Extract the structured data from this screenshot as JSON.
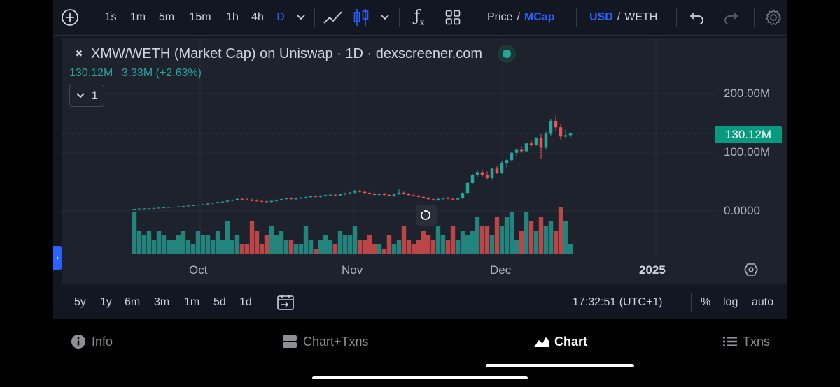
{
  "toolbar": {
    "intervals": [
      "1s",
      "1m",
      "5m",
      "15m",
      "1h",
      "4h",
      "D"
    ],
    "active_interval": "D",
    "price_label": "Price",
    "slash": "/",
    "mcap_label": "MCap",
    "currency_primary": "USD",
    "currency_secondary": "WETH"
  },
  "legend": {
    "title": "XMW/WETH (Market Cap) on Uniswap · 1D · dexscreener.com",
    "value": "130.12M",
    "change": "3.33M (+2.63%)",
    "collapse_count": "1"
  },
  "price_axis": {
    "labels": [
      "200.00M",
      "100.00M",
      "0.0000"
    ],
    "current_price": "130.12M"
  },
  "time_axis": {
    "labels": [
      "Oct",
      "Nov",
      "Dec",
      "2025"
    ]
  },
  "colors": {
    "up": "#26a69a",
    "down": "#ef5350",
    "accent": "#2962ff",
    "background": "#131722",
    "chart_bg": "#1e222d"
  },
  "chart_data": {
    "type": "candlestick",
    "price_axis_values": [
      0,
      100000000,
      200000000
    ],
    "last_price": 130120000,
    "ylim": [
      -20000000,
      240000000
    ],
    "candles": [
      {
        "o": 1.0,
        "h": 1.4,
        "l": 0.5,
        "c": 1.2
      },
      {
        "o": 1.2,
        "h": 1.7,
        "l": 0.9,
        "c": 1.6
      },
      {
        "o": 1.6,
        "h": 2.1,
        "l": 1.3,
        "c": 1.9
      },
      {
        "o": 1.9,
        "h": 2.3,
        "l": 1.5,
        "c": 2.1
      },
      {
        "o": 2.1,
        "h": 2.8,
        "l": 1.8,
        "c": 2.6
      },
      {
        "o": 2.6,
        "h": 3.3,
        "l": 2.3,
        "c": 3.1
      },
      {
        "o": 3.1,
        "h": 3.7,
        "l": 2.7,
        "c": 3.4
      },
      {
        "o": 3.4,
        "h": 4.4,
        "l": 3.0,
        "c": 4.2
      },
      {
        "o": 4.2,
        "h": 4.9,
        "l": 3.7,
        "c": 4.6
      },
      {
        "o": 4.6,
        "h": 5.6,
        "l": 4.1,
        "c": 5.3
      },
      {
        "o": 5.3,
        "h": 6.2,
        "l": 4.8,
        "c": 5.9
      },
      {
        "o": 5.9,
        "h": 7.0,
        "l": 5.3,
        "c": 6.7
      },
      {
        "o": 6.7,
        "h": 7.8,
        "l": 6.0,
        "c": 7.4
      },
      {
        "o": 7.4,
        "h": 8.6,
        "l": 6.6,
        "c": 8.2
      },
      {
        "o": 8.2,
        "h": 9.5,
        "l": 7.2,
        "c": 8.8
      },
      {
        "o": 8.8,
        "h": 10.8,
        "l": 7.9,
        "c": 10.2
      },
      {
        "o": 10.2,
        "h": 12.1,
        "l": 9.0,
        "c": 11.6
      },
      {
        "o": 11.6,
        "h": 13.4,
        "l": 10.5,
        "c": 12.8
      },
      {
        "o": 12.8,
        "h": 14.2,
        "l": 11.6,
        "c": 13.5
      },
      {
        "o": 13.5,
        "h": 15.7,
        "l": 12.2,
        "c": 15.1
      },
      {
        "o": 15.1,
        "h": 17.2,
        "l": 14.0,
        "c": 16.6
      },
      {
        "o": 16.6,
        "h": 19.0,
        "l": 15.4,
        "c": 18.2
      },
      {
        "o": 18.2,
        "h": 20.3,
        "l": 16.5,
        "c": 17.1
      },
      {
        "o": 17.1,
        "h": 19.8,
        "l": 15.3,
        "c": 16.0
      },
      {
        "o": 16.0,
        "h": 18.5,
        "l": 14.2,
        "c": 15.1
      },
      {
        "o": 15.1,
        "h": 17.3,
        "l": 13.6,
        "c": 14.4
      },
      {
        "o": 14.4,
        "h": 16.1,
        "l": 12.7,
        "c": 13.8
      },
      {
        "o": 13.8,
        "h": 15.9,
        "l": 11.9,
        "c": 13.1
      },
      {
        "o": 13.1,
        "h": 15.4,
        "l": 11.6,
        "c": 14.6
      },
      {
        "o": 14.6,
        "h": 17.1,
        "l": 13.1,
        "c": 16.4
      },
      {
        "o": 16.4,
        "h": 18.6,
        "l": 14.7,
        "c": 17.7
      },
      {
        "o": 17.7,
        "h": 19.4,
        "l": 16.0,
        "c": 18.9
      },
      {
        "o": 18.9,
        "h": 20.8,
        "l": 17.2,
        "c": 17.6
      },
      {
        "o": 17.6,
        "h": 20.1,
        "l": 16.3,
        "c": 19.3
      },
      {
        "o": 19.3,
        "h": 21.2,
        "l": 17.9,
        "c": 20.6
      },
      {
        "o": 20.6,
        "h": 22.3,
        "l": 18.6,
        "c": 21.1
      },
      {
        "o": 21.1,
        "h": 23.4,
        "l": 19.6,
        "c": 22.5
      },
      {
        "o": 22.5,
        "h": 24.1,
        "l": 20.8,
        "c": 21.7
      },
      {
        "o": 21.7,
        "h": 24.6,
        "l": 20.2,
        "c": 23.9
      },
      {
        "o": 23.9,
        "h": 25.8,
        "l": 22.1,
        "c": 24.7
      },
      {
        "o": 24.7,
        "h": 26.9,
        "l": 23.0,
        "c": 25.3
      },
      {
        "o": 25.3,
        "h": 27.4,
        "l": 23.4,
        "c": 24.2
      },
      {
        "o": 24.2,
        "h": 27.1,
        "l": 22.9,
        "c": 26.4
      },
      {
        "o": 26.4,
        "h": 28.8,
        "l": 24.5,
        "c": 27.7
      },
      {
        "o": 27.7,
        "h": 30.1,
        "l": 25.9,
        "c": 28.9
      },
      {
        "o": 28.9,
        "h": 33.5,
        "l": 27.2,
        "c": 31.8
      },
      {
        "o": 31.8,
        "h": 34.1,
        "l": 29.3,
        "c": 30.2
      },
      {
        "o": 30.2,
        "h": 31.9,
        "l": 27.6,
        "c": 28.4
      },
      {
        "o": 28.4,
        "h": 30.2,
        "l": 25.8,
        "c": 26.5
      },
      {
        "o": 26.5,
        "h": 28.7,
        "l": 24.3,
        "c": 25.1
      },
      {
        "o": 25.1,
        "h": 27.4,
        "l": 22.9,
        "c": 26.6
      },
      {
        "o": 26.6,
        "h": 28.8,
        "l": 24.0,
        "c": 25.0
      },
      {
        "o": 25.0,
        "h": 26.9,
        "l": 22.4,
        "c": 23.6
      },
      {
        "o": 23.6,
        "h": 27.3,
        "l": 21.9,
        "c": 26.4
      },
      {
        "o": 26.4,
        "h": 35.1,
        "l": 25.2,
        "c": 28.8
      },
      {
        "o": 28.8,
        "h": 30.7,
        "l": 25.6,
        "c": 26.8
      },
      {
        "o": 26.8,
        "h": 28.5,
        "l": 23.9,
        "c": 24.7
      },
      {
        "o": 24.7,
        "h": 26.2,
        "l": 22.1,
        "c": 23.2
      },
      {
        "o": 23.2,
        "h": 25.3,
        "l": 20.7,
        "c": 21.6
      },
      {
        "o": 21.6,
        "h": 23.4,
        "l": 19.1,
        "c": 19.9
      },
      {
        "o": 19.9,
        "h": 21.8,
        "l": 16.8,
        "c": 17.6
      },
      {
        "o": 17.6,
        "h": 19.6,
        "l": 14.9,
        "c": 16.1
      },
      {
        "o": 16.1,
        "h": 19.1,
        "l": 15.0,
        "c": 18.3
      },
      {
        "o": 18.3,
        "h": 20.6,
        "l": 16.9,
        "c": 19.6
      },
      {
        "o": 19.6,
        "h": 21.3,
        "l": 17.4,
        "c": 18.2
      },
      {
        "o": 18.2,
        "h": 20.2,
        "l": 15.9,
        "c": 17.1
      },
      {
        "o": 17.1,
        "h": 19.7,
        "l": 15.4,
        "c": 18.9
      },
      {
        "o": 18.9,
        "h": 29.3,
        "l": 18.2,
        "c": 28.4
      },
      {
        "o": 28.4,
        "h": 47.6,
        "l": 26.7,
        "c": 45.3
      },
      {
        "o": 45.3,
        "h": 61.1,
        "l": 43.5,
        "c": 58.5
      },
      {
        "o": 58.5,
        "h": 66.7,
        "l": 55.2,
        "c": 63.7
      },
      {
        "o": 63.7,
        "h": 68.4,
        "l": 56.3,
        "c": 59.0
      },
      {
        "o": 59.0,
        "h": 65.2,
        "l": 52.2,
        "c": 53.6
      },
      {
        "o": 53.6,
        "h": 71.4,
        "l": 52.0,
        "c": 69.8
      },
      {
        "o": 69.8,
        "h": 75.0,
        "l": 60.8,
        "c": 62.1
      },
      {
        "o": 62.1,
        "h": 82.2,
        "l": 60.7,
        "c": 79.4
      },
      {
        "o": 79.4,
        "h": 86.1,
        "l": 72.3,
        "c": 84.2
      },
      {
        "o": 84.2,
        "h": 98.5,
        "l": 82.3,
        "c": 96.7
      },
      {
        "o": 96.7,
        "h": 104.1,
        "l": 90.1,
        "c": 101.7
      },
      {
        "o": 101.7,
        "h": 108.2,
        "l": 96.0,
        "c": 99.5
      },
      {
        "o": 99.5,
        "h": 114.3,
        "l": 97.7,
        "c": 112.8
      },
      {
        "o": 112.8,
        "h": 118.4,
        "l": 107.1,
        "c": 110.5
      },
      {
        "o": 110.5,
        "h": 123.6,
        "l": 108.8,
        "c": 121.4
      },
      {
        "o": 121.4,
        "h": 128.4,
        "l": 86.9,
        "c": 105.5
      },
      {
        "o": 105.5,
        "h": 132.7,
        "l": 102.1,
        "c": 129.3
      },
      {
        "o": 129.3,
        "h": 154.5,
        "l": 126.4,
        "c": 151.3
      },
      {
        "o": 151.3,
        "h": 159.8,
        "l": 133.3,
        "c": 140.2
      },
      {
        "o": 140.2,
        "h": 146.6,
        "l": 118.9,
        "c": 124.6
      },
      {
        "o": 124.6,
        "h": 136.4,
        "l": 122.3,
        "c": 126.8
      },
      {
        "o": 126.8,
        "h": 131.3,
        "l": 123.1,
        "c": 130.1
      }
    ],
    "volumes": [
      9,
      5,
      4,
      5,
      3,
      5,
      4,
      3,
      3,
      4,
      5,
      3,
      2,
      5,
      4,
      4,
      3,
      5,
      3,
      7,
      3,
      4,
      2,
      2,
      7,
      5,
      2,
      4,
      6,
      4,
      5,
      3,
      3,
      2,
      2,
      6,
      3,
      1,
      3,
      4,
      3,
      2,
      5,
      4,
      4,
      6,
      3,
      3,
      4,
      2,
      2,
      1,
      4,
      2,
      3,
      6,
      3,
      2,
      3,
      5,
      4,
      3,
      6,
      4,
      3,
      6,
      3,
      5,
      4,
      5,
      8,
      6,
      6,
      4,
      8,
      6,
      8,
      9,
      3,
      5,
      9,
      7,
      5,
      8,
      6,
      7,
      5,
      10,
      7,
      2,
      2
    ]
  },
  "reset_button_icon": "reset-icon",
  "bottom_bar": {
    "ranges": [
      "5y",
      "1y",
      "6m",
      "3m",
      "1m",
      "5d",
      "1d"
    ],
    "time": "17:32:51 (UTC+1)",
    "percent_label": "%",
    "log_label": "log",
    "auto_label": "auto"
  },
  "nav": {
    "items": [
      "Info",
      "Chart+Txns",
      "Chart",
      "Txns"
    ],
    "active": "Chart"
  }
}
